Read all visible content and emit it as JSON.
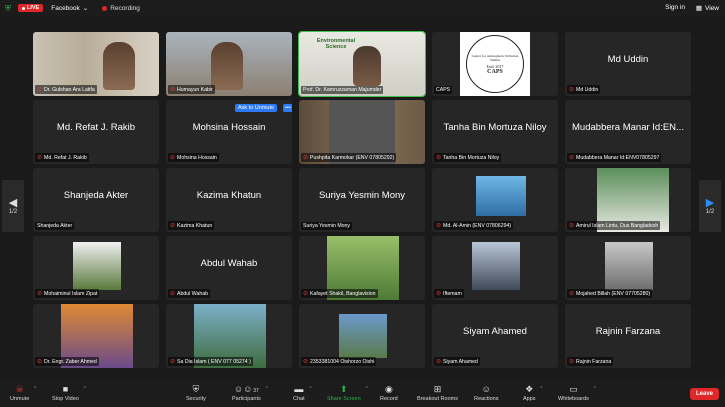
{
  "topbar": {
    "live": "LIVE",
    "platform": "Facebook",
    "recording": "Recording",
    "sign_in": "Sign in",
    "view": "View"
  },
  "pager": {
    "left": "1/2",
    "right": "1/2"
  },
  "tiles": [
    {
      "name": "Dr. Gulshan Ara Latifa",
      "big": "",
      "muted": true
    },
    {
      "name": "Humayun Kabir",
      "big": "",
      "muted": true
    },
    {
      "name": "Prof. Dr. Kamruzzaman Majumder",
      "big": "",
      "muted": false,
      "banner": "Environmental Science"
    },
    {
      "name": "CAPS",
      "big": "",
      "muted": false,
      "logo_top": "Center for Atmospheric Pollution Studies",
      "logo_mid": "Estd. 2017",
      "logo_bottom": "CAPS"
    },
    {
      "name": "Md Uddin",
      "big": "Md Uddin",
      "muted": true
    },
    {
      "name": "Md. Refat J. Rakib",
      "big": "Md. Refat J. Rakib",
      "muted": true
    },
    {
      "name": "Mohsina Hossain",
      "big": "Mohsina Hossain",
      "muted": true,
      "ask": "Ask to Unmute",
      "more": "•••"
    },
    {
      "name": "Pushpita Karmokar (ENV 07805292)",
      "big": "",
      "muted": true
    },
    {
      "name": "Tanha Bin Mortuza Niloy",
      "big": "Tanha Bin Mortuza Niloy",
      "muted": true
    },
    {
      "name": "Mudabbera Manar Id:ENV07805297",
      "big": "Mudabbera Manar Id:EN...",
      "muted": true
    },
    {
      "name": "Shanjeda Akter",
      "big": "Shanjeda Akter",
      "muted": false
    },
    {
      "name": "Kazima Khatun",
      "big": "Kazima Khatun",
      "muted": true
    },
    {
      "name": "Suriya Yesmin Mony",
      "big": "Suriya Yesmin Mony",
      "muted": false
    },
    {
      "name": "Md. Al-Amin (ENV 07806294)",
      "big": "",
      "muted": true
    },
    {
      "name": "Amirul Islam Lintu, Dus Bangladesh",
      "big": "",
      "muted": true
    },
    {
      "name": "Mohaiminul Islam Zipat",
      "big": "",
      "muted": true
    },
    {
      "name": "Abdul Wahab",
      "big": "Abdul Wahab",
      "muted": true
    },
    {
      "name": "Kafayet Shakil, Banglavision",
      "big": "",
      "muted": true
    },
    {
      "name": "Iftemam",
      "big": "",
      "muted": true
    },
    {
      "name": "Mojahed Billah (ENV 07705280)",
      "big": "",
      "muted": true
    },
    {
      "name": "Dr. Engr. Zaber Ahmed",
      "big": "",
      "muted": true
    },
    {
      "name": "Sa Dia Islam ( ENV 077 05274 )",
      "big": "",
      "muted": true
    },
    {
      "name": "2353381004 Oishorzo Oishi",
      "big": "",
      "muted": true
    },
    {
      "name": "Siyam Ahamed",
      "big": "Siyam Ahamed",
      "muted": true
    },
    {
      "name": "Rajnin Farzana",
      "big": "Rajnin Farzana",
      "muted": true
    }
  ],
  "toolbar": {
    "unmute": "Unmute",
    "stop_video": "Stop Video",
    "security": "Security",
    "participants": "Participants",
    "participants_count": "37",
    "chat": "Chat",
    "share_screen": "Share Screen",
    "record": "Record",
    "breakout_rooms": "Breakout Rooms",
    "reactions": "Reactions",
    "apps": "Apps",
    "whiteboards": "Whiteboards",
    "leave": "Leave"
  },
  "colors": {
    "accent_green": "#29b24a",
    "live_red": "#e02828",
    "ask_blue": "#2d7af6"
  }
}
